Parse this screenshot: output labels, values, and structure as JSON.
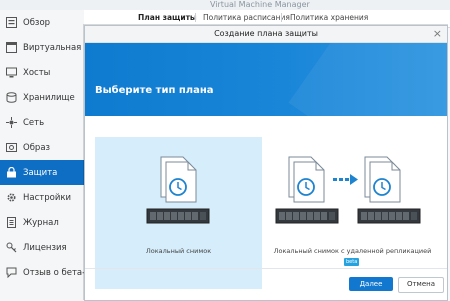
{
  "app": {
    "title": "Virtual Machine Manager"
  },
  "sidebar": {
    "items": [
      {
        "label": "Обзор",
        "icon": "overview-icon"
      },
      {
        "label": "Виртуальная ма",
        "icon": "virtual-machine-icon"
      },
      {
        "label": "Хосты",
        "icon": "host-icon"
      },
      {
        "label": "Хранилище",
        "icon": "storage-icon"
      },
      {
        "label": "Сеть",
        "icon": "network-icon"
      },
      {
        "label": "Образ",
        "icon": "image-icon"
      },
      {
        "label": "Защита",
        "icon": "protection-icon",
        "active": true
      },
      {
        "label": "Настройки",
        "icon": "gear-icon"
      },
      {
        "label": "Журнал",
        "icon": "log-icon"
      },
      {
        "label": "Лицензия",
        "icon": "license-icon"
      },
      {
        "label": "Отзыв о бета-ве",
        "icon": "feedback-icon"
      }
    ]
  },
  "tabs": [
    {
      "label": "План защиты",
      "active": true
    },
    {
      "label": "Политика расписания"
    },
    {
      "label": "Политика хранения"
    }
  ],
  "modal": {
    "title": "Создание плана защиты",
    "heading": "Выберите тип плана",
    "options": [
      {
        "label": "Локальный снимок",
        "selected": true
      },
      {
        "label": "Локальный снимок с удаленной репликацией",
        "badge": "beta"
      }
    ],
    "next_label": "Далее",
    "cancel_label": "Отмена"
  },
  "colors": {
    "accent": "#0e6ec3",
    "banner": "#1582d5",
    "selected_option": "#d6edfb",
    "beta_badge": "#26a3df"
  }
}
